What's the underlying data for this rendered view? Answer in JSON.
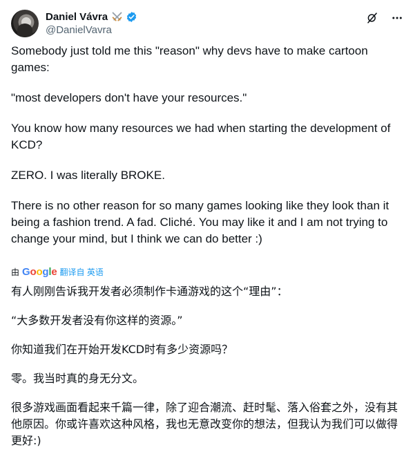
{
  "author": {
    "name": "Daniel Vávra",
    "handle": "@DanielVavra",
    "badge_emoji": "crossed-swords-icon",
    "verified": true
  },
  "tweet": {
    "paragraphs": [
      "Somebody just told me this \"reason\" why devs have to make cartoon games:",
      "\"most developers don't have your resources.\"",
      "You know how many resources we had when starting the development of KCD?",
      "ZERO. I was literally BROKE.",
      "There is no other reason for so many games looking like they look than it being a fashion trend. A fad. Cliché. You may like it and I am not trying to change your mind, but I think we can do better :)"
    ]
  },
  "translation": {
    "prefix": "由",
    "provider": "Google",
    "action_label": "翻译自 英语",
    "paragraphs": [
      "有人刚刚告诉我开发者必须制作卡通游戏的这个“理由”：",
      "“大多数开发者没有你这样的资源。”",
      "你知道我们在开始开发KCD时有多少资源吗？",
      "零。我当时真的身无分文。",
      "很多游戏画面看起来千篇一律，除了迎合潮流、赶时髦、落入俗套之外，没有其他原因。你或许喜欢这种风格，我也无意改变你的想法，但我认为我们可以做得更好:)"
    ]
  },
  "icons": {
    "grok": "grok-icon",
    "more": "more-icon"
  },
  "colors": {
    "text": "#0f1419",
    "secondary": "#536471",
    "verified": "#1d9bf0",
    "link": "#1d9bf0"
  }
}
